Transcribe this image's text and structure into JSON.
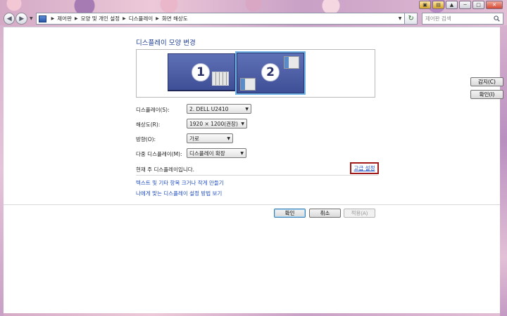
{
  "address": {
    "crumbs": [
      "제어판",
      "모양 및 개인 설정",
      "디스플레이",
      "화면 해상도"
    ]
  },
  "search": {
    "placeholder": "제어판 검색"
  },
  "page": {
    "title": "디스플레이 모양 변경"
  },
  "preview": {
    "monitors": [
      {
        "number": "1",
        "selected": false
      },
      {
        "number": "2",
        "selected": true
      }
    ],
    "detect_label": "감지(C)",
    "identify_label": "확인(I)"
  },
  "settings": {
    "display_label": "디스플레이(S):",
    "display_value": "2. DELL U2410",
    "resolution_label": "해상도(R):",
    "resolution_value": "1920 × 1200(권장)",
    "orientation_label": "방향(O):",
    "orientation_value": "가로",
    "multiple_label": "다중 디스플레이(M):",
    "multiple_value": "디스플레이 확장"
  },
  "status": {
    "primary_text": "현재 주 디스플레이입니다.",
    "advanced_link": "고급 설정"
  },
  "links": {
    "text_size": "텍스트 및 기타 항목 크거나 작게 만들기",
    "help": "나에게 맞는 디스플레이 설정 방법 보기"
  },
  "buttons": {
    "ok": "확인",
    "cancel": "취소",
    "apply": "적용(A)"
  },
  "colors": {
    "link": "#1f4ec0",
    "title": "#1e3f93",
    "monitor": "#4a5ba6",
    "highlight_box": "#a21a1a"
  }
}
